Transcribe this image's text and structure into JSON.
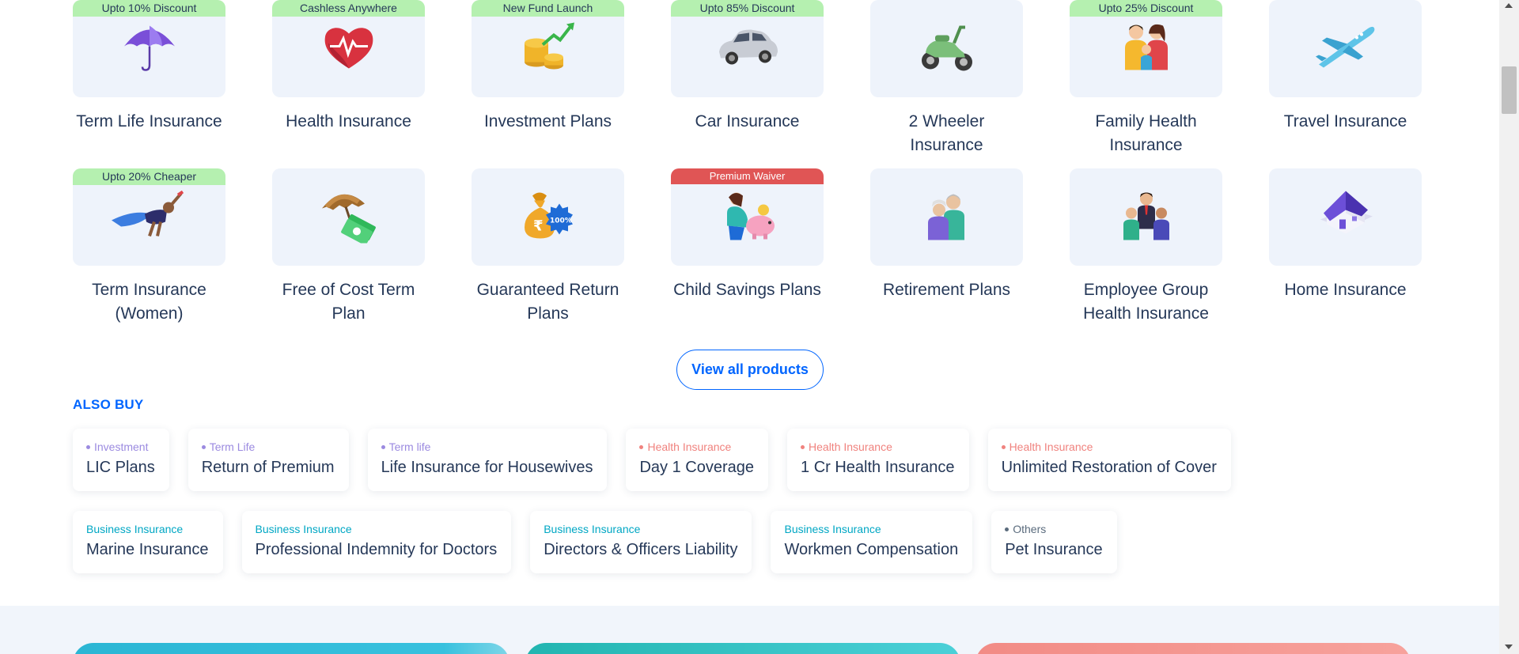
{
  "products": [
    {
      "label": "Term Life Insurance",
      "badge": "Upto 10% Discount",
      "badge_color": "green",
      "icon": "umbrella-icon"
    },
    {
      "label": "Health Insurance",
      "badge": "Cashless Anywhere",
      "badge_color": "green",
      "icon": "heart-pulse-icon"
    },
    {
      "label": "Investment Plans",
      "badge": "New Fund Launch",
      "badge_color": "green",
      "icon": "coins-growth-icon"
    },
    {
      "label": "Car Insurance",
      "badge": "Upto 85% Discount",
      "badge_color": "green",
      "icon": "car-icon"
    },
    {
      "label": "2 Wheeler Insurance",
      "badge": "",
      "badge_color": "",
      "icon": "scooter-icon"
    },
    {
      "label": "Family Health Insurance",
      "badge": "Upto 25% Discount",
      "badge_color": "green",
      "icon": "family-icon"
    },
    {
      "label": "Travel Insurance",
      "badge": "",
      "badge_color": "",
      "icon": "airplane-icon"
    },
    {
      "label": "Term Insurance (Women)",
      "badge": "Upto 20% Cheaper",
      "badge_color": "green",
      "icon": "superwoman-icon"
    },
    {
      "label": "Free of Cost Term Plan",
      "badge": "",
      "badge_color": "",
      "icon": "umbrella-cash-icon"
    },
    {
      "label": "Guaranteed Return Plans",
      "badge": "",
      "badge_color": "",
      "icon": "money-bag-100-icon"
    },
    {
      "label": "Child Savings Plans",
      "badge": "Premium Waiver",
      "badge_color": "red",
      "icon": "child-piggybank-icon"
    },
    {
      "label": "Retirement Plans",
      "badge": "",
      "badge_color": "",
      "icon": "elderly-couple-icon"
    },
    {
      "label": "Employee Group Health Insurance",
      "badge": "",
      "badge_color": "",
      "icon": "employee-group-icon"
    },
    {
      "label": "Home Insurance",
      "badge": "",
      "badge_color": "",
      "icon": "house-icon"
    }
  ],
  "view_all_label": "View all products",
  "also_buy_heading": "ALSO BUY",
  "also_buy_row1": [
    {
      "category": "Investment",
      "title": "LIC Plans",
      "color": "#9b8ae0",
      "dot": true
    },
    {
      "category": "Term Life",
      "title": "Return of Premium",
      "color": "#9b8ae0",
      "dot": true
    },
    {
      "category": "Term life",
      "title": "Life Insurance for Housewives",
      "color": "#9b8ae0",
      "dot": true
    },
    {
      "category": "Health Insurance",
      "title": "Day 1 Coverage",
      "color": "#f0827e",
      "dot": true
    },
    {
      "category": "Health Insurance",
      "title": "1 Cr Health Insurance",
      "color": "#f0827e",
      "dot": true
    },
    {
      "category": "Health Insurance",
      "title": "Unlimited Restoration of Cover",
      "color": "#f0827e",
      "dot": true
    }
  ],
  "also_buy_row2": [
    {
      "category": "Business Insurance",
      "title": "Marine Insurance",
      "color": "#00a7c4",
      "dot": false
    },
    {
      "category": "Business Insurance",
      "title": "Professional Indemnity for Doctors",
      "color": "#00a7c4",
      "dot": false
    },
    {
      "category": "Business Insurance",
      "title": "Directors & Officers Liability",
      "color": "#00a7c4",
      "dot": false
    },
    {
      "category": "Business Insurance",
      "title": "Workmen Compensation",
      "color": "#00a7c4",
      "dot": false
    },
    {
      "category": "Others",
      "title": "Pet Insurance",
      "color": "#5a6b7d",
      "dot": true
    }
  ],
  "colors": {
    "accent": "#0065ff",
    "card_bg": "#eef3fb",
    "badge_green": "#b5f0b0",
    "badge_red": "#e05555",
    "banner_1": "#2bb6d4",
    "banner_2": "#2ec4c4",
    "banner_3": "#f28b85"
  }
}
